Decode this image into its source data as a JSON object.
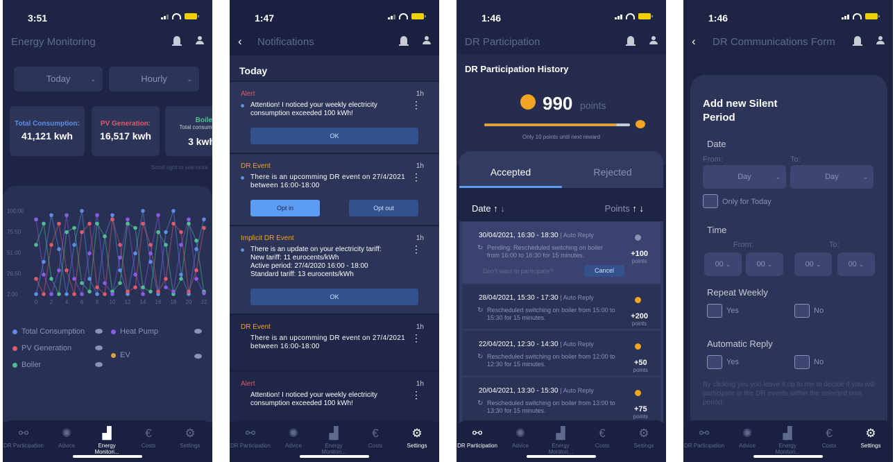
{
  "status": {
    "times": [
      "3:51",
      "1:47",
      "1:46",
      "1:46"
    ]
  },
  "tabs": [
    "DR Participation",
    "Advice",
    "Energy Monitori...",
    "Costs",
    "Settings"
  ],
  "screen1": {
    "title": "Energy Monitoring",
    "dd_period": "Today",
    "dd_interval": "Hourly",
    "cards": [
      {
        "label": "Total Consumption:",
        "value": "41,121 kwh",
        "color": "#5c8ee6"
      },
      {
        "label": "PV Generation:",
        "value": "16,517 kwh",
        "color": "#e05a6a"
      },
      {
        "label": "Boiler",
        "sublabel": "Total consump",
        "value": "3 kwh",
        "color": "#4fbf8f"
      }
    ],
    "scroll_hint": "Scroll right to see more",
    "legend": [
      {
        "label": "Total Consumption",
        "color": "#5c8ee6"
      },
      {
        "label": "Heat Pump",
        "color": "#8a5ce6"
      },
      {
        "label": "PV Generation",
        "color": "#e05a6a"
      },
      {
        "label": "EV",
        "color": "#d9a23c"
      },
      {
        "label": "Boiler",
        "color": "#4fbf8f"
      }
    ]
  },
  "chart_data": {
    "type": "line",
    "x": [
      0,
      1,
      2,
      3,
      4,
      5,
      6,
      7,
      8,
      9,
      10,
      11,
      12,
      13,
      14,
      15,
      16,
      17,
      18,
      19,
      20,
      21,
      22
    ],
    "x_tick_labels": [
      "0",
      "2",
      "4",
      "6",
      "8",
      "10",
      "12",
      "14",
      "16",
      "18",
      "20",
      "22"
    ],
    "y_tick_labels": [
      "2.00",
      "26.50",
      "51.00",
      "75.50",
      "100.00"
    ],
    "ylim": [
      2,
      100
    ],
    "series": [
      {
        "name": "Total Consumption",
        "color": "#5c8ee6",
        "values": [
          2,
          40,
          95,
          55,
          2,
          60,
          100,
          20,
          2,
          70,
          95,
          30,
          2,
          50,
          100,
          40,
          2,
          75,
          100,
          25,
          2,
          55,
          90
        ]
      },
      {
        "name": "PV Generation",
        "color": "#e05a6a",
        "values": [
          20,
          2,
          60,
          85,
          30,
          2,
          75,
          85,
          10,
          2,
          90,
          60,
          5,
          10,
          85,
          60,
          5,
          20,
          85,
          75,
          5,
          30,
          80
        ]
      },
      {
        "name": "Boiler",
        "color": "#4fbf8f",
        "values": [
          60,
          85,
          20,
          2,
          75,
          80,
          15,
          5,
          85,
          70,
          5,
          15,
          85,
          80,
          10,
          5,
          75,
          60,
          2,
          20,
          85,
          65,
          5
        ]
      },
      {
        "name": "Heat Pump",
        "color": "#8a5ce6",
        "values": [
          90,
          25,
          2,
          30,
          95,
          20,
          2,
          50,
          95,
          15,
          2,
          45,
          90,
          25,
          2,
          50,
          95,
          10,
          5,
          60,
          90,
          20,
          3
        ]
      }
    ]
  },
  "screen2": {
    "title": "Notifications",
    "section": "Today",
    "notifications": [
      {
        "title": "Alert",
        "title_color": "#e05a6a",
        "time": "1h",
        "msg": "Attention! I noticed your weekly electricity consumption exceeded 100 kWh!",
        "btn": "OK"
      },
      {
        "title": "DR Event",
        "title_color": "#f3a423",
        "time": "1h",
        "msg": "There is an upcomming DR event on 27/4/2021 between 16:00-18:00",
        "btn1": "Opt in",
        "btn2": "Opt out"
      },
      {
        "title": "Implicit DR Event",
        "title_color": "#f3a423",
        "time": "1h",
        "msg1": "There is an update on your electricity tariff:",
        "msg2": "New tariff:  11 eurocents/kWh",
        "msg3": "Active period: 27/4/2020 16:00 - 18:00",
        "msg4": "Standard tariff: 13 eurocents/kWh",
        "btn": "OK"
      },
      {
        "title": "DR Event",
        "title_color": "#f3a423",
        "time": "1h",
        "msg": "There is an upcomming DR event on 27/4/2021 between 16:00-18:00"
      },
      {
        "title": "Alert",
        "title_color": "#e05a6a",
        "time": "1h",
        "msg": "Attention! I noticed your weekly electricity consumption exceeded 100 kWh!"
      }
    ]
  },
  "screen3": {
    "title": "DR Participation",
    "header": "DR Participation History",
    "points_value": "990",
    "points_word": "points",
    "progress": 0.91,
    "progress_hint": "Only 10 points until next reward",
    "tab_accepted": "Accepted",
    "tab_rejected": "Rejected",
    "sort_date": "Date",
    "sort_points": "Points",
    "history": [
      {
        "date": "30/04/2021, 16:30 - 18:30",
        "type": "| Auto Reply",
        "status": "Pending: Rescheduled switching on boiler from 16:00 to 16:30 for 15 minutes.",
        "points": "+100",
        "unit": "points",
        "decline": "Don't want to participate?",
        "cancel": "Cancel"
      },
      {
        "date": "28/04/2021, 15:30 - 17:30",
        "type": "| Auto Reply",
        "status": "Rescheduled switching on boiler from 15:00 to 15:30 for 15 minutes.",
        "points": "+200",
        "unit": "points"
      },
      {
        "date": "22/04/2021, 12:30 - 14:30",
        "type": "| Auto Reply",
        "status": "Rescheduled switching on boiler from 12:00 to 12:30 for 15 minutes.",
        "points": "+50",
        "unit": "points"
      },
      {
        "date": "20/04/2021, 13:30 - 15:30",
        "type": "| Auto Reply",
        "status": "Rescheduled switching on boiler from 13:00 to 13:30 for 15 minutes.",
        "points": "+75",
        "unit": "points"
      }
    ]
  },
  "screen4": {
    "title": "DR Communications Form",
    "form_title1": "Add new Silent",
    "form_title2": "Period",
    "date_label": "Date",
    "from": "From:",
    "to": "To:",
    "day": "Day",
    "only_today": "Only for Today",
    "time_label": "Time",
    "zero": "00",
    "repeat_weekly": "Repeat Weekly",
    "auto_reply": "Automatic Reply",
    "yes": "Yes",
    "no": "No",
    "disclaimer": "By clicking yes you leave it up to me to decide if you will participate in the DR events within the selected time period."
  }
}
